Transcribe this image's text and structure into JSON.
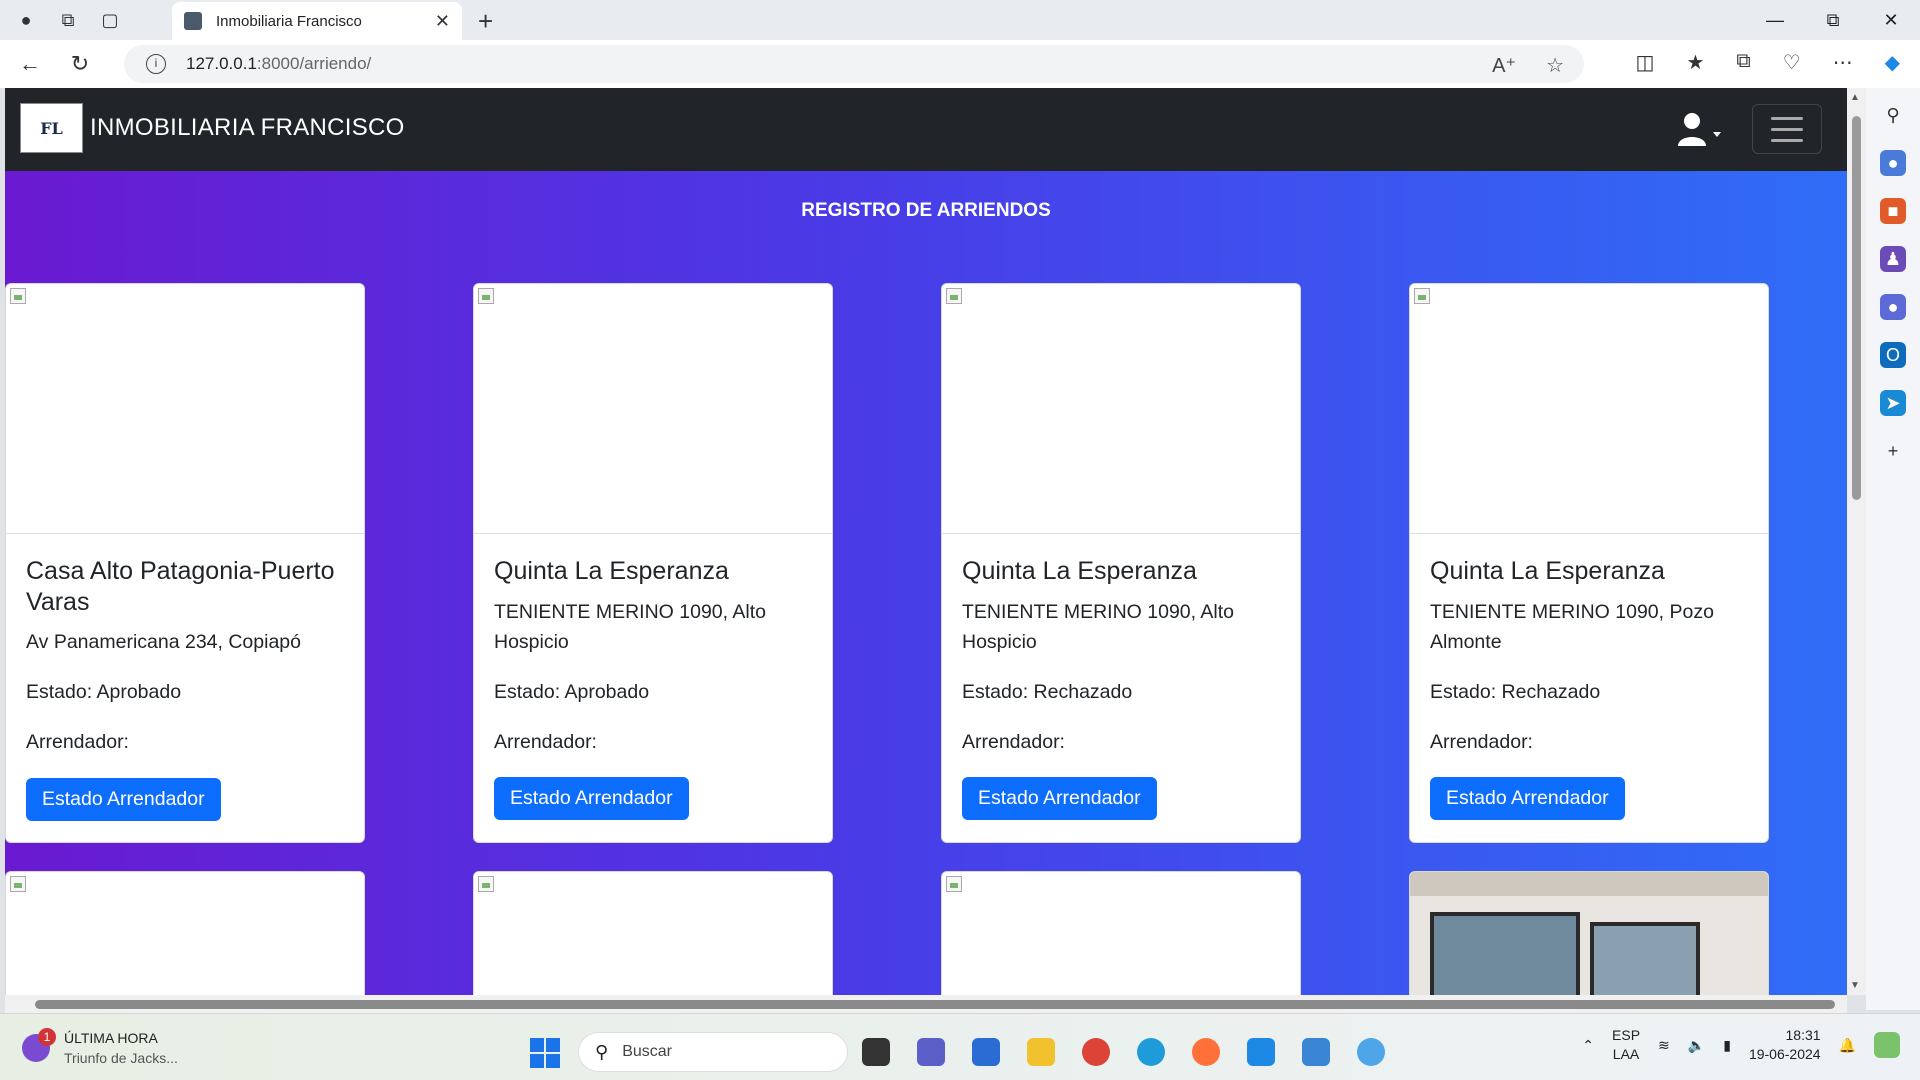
{
  "browser": {
    "tab_title": "Inmobiliaria Francisco",
    "url_host": "127.0.0.1",
    "url_path": ":8000/arriendo/"
  },
  "navbar": {
    "brand": "INMOBILIARIA FRANCISCO",
    "logo_text": "FL"
  },
  "page": {
    "title": "REGISTRO DE ARRIENDOS"
  },
  "cards": [
    {
      "title": "Casa Alto Patagonia-Puerto Varas",
      "address": "Av Panamericana 234, Copiapó",
      "estado": "Estado: Aprobado",
      "arrendador": "Arrendador:",
      "button": "Estado Arrendador"
    },
    {
      "title": "Quinta La Esperanza",
      "address": "TENIENTE MERINO 1090, Alto Hospicio",
      "estado": "Estado: Aprobado",
      "arrendador": "Arrendador:",
      "button": "Estado Arrendador"
    },
    {
      "title": "Quinta La Esperanza",
      "address": "TENIENTE MERINO 1090, Alto Hospicio",
      "estado": "Estado: Rechazado",
      "arrendador": "Arrendador:",
      "button": "Estado Arrendador"
    },
    {
      "title": "Quinta La Esperanza",
      "address": "TENIENTE MERINO 1090, Pozo Almonte",
      "estado": "Estado: Rechazado",
      "arrendador": "Arrendador:",
      "button": "Estado Arrendador"
    }
  ],
  "taskbar": {
    "news_badge": "1",
    "news_title": "ÚLTIMA HORA",
    "news_sub": "Triunfo de Jacks...",
    "search_placeholder": "Buscar",
    "lang_top": "ESP",
    "lang_bottom": "LAA",
    "time": "18:31",
    "date": "19-06-2024"
  }
}
